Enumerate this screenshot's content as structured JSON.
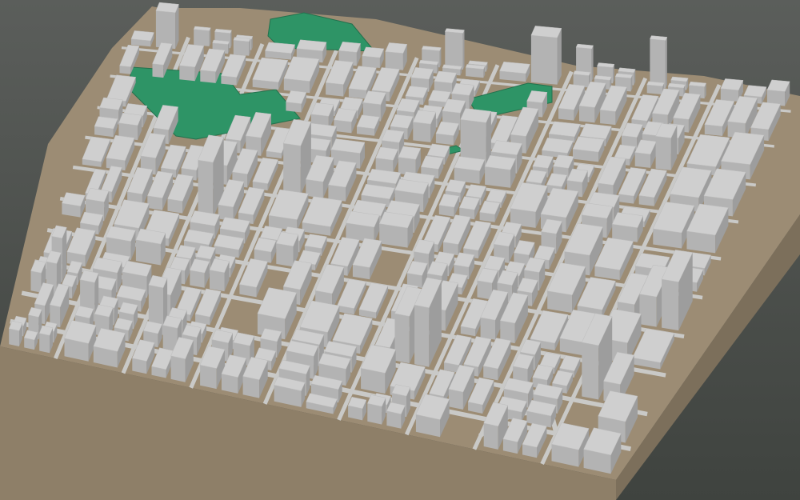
{
  "scene": {
    "type": "3d-city-block-model",
    "colors": {
      "background_top": "#5b5e5b",
      "background_bottom": "#3f433f",
      "ground": "#9c8c74",
      "base_front": "#8e7f68",
      "base_right": "#7c6f5b",
      "road": "#c9c9c7",
      "building_roof": "#cfcfcf",
      "building_left": "#b3b3b3",
      "building_right": "#9d9d9d",
      "park": "#2e9466",
      "park_dark": "#23704d"
    },
    "park_count": 4,
    "features": [
      "building-footprints",
      "road-network",
      "parks",
      "terrain-base"
    ]
  }
}
